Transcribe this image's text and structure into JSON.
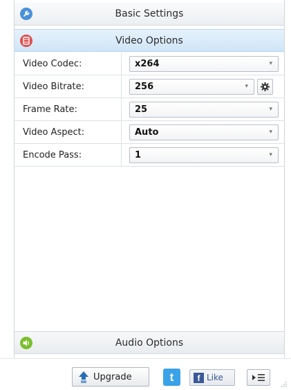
{
  "sections": {
    "basic": {
      "title": "Basic Settings",
      "icon": "wrench-icon",
      "color": "#4a90d9"
    },
    "video": {
      "title": "Video Options",
      "icon": "film-icon",
      "color": "#e05050"
    },
    "audio": {
      "title": "Audio Options",
      "icon": "speaker-icon",
      "color": "#7cbf2e"
    }
  },
  "video_options": [
    {
      "label": "Video Codec:",
      "value": "x264"
    },
    {
      "label": "Video Bitrate:",
      "value": "256"
    },
    {
      "label": "Frame Rate:",
      "value": "25"
    },
    {
      "label": "Video Aspect:",
      "value": "Auto"
    },
    {
      "label": "Encode Pass:",
      "value": "1"
    }
  ],
  "footer": {
    "upgrade_label": "Upgrade",
    "like_label": "Like",
    "facebook_glyph": "f",
    "twitter_glyph": "t"
  },
  "icons": {
    "caret": "▾",
    "gear": "gear-icon"
  }
}
